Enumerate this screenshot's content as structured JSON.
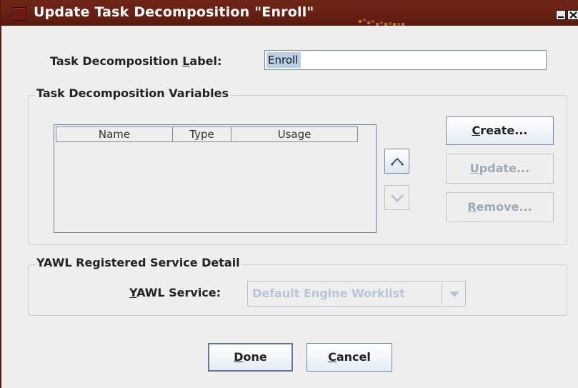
{
  "window": {
    "title": "Update Task Decomposition  \"Enroll\"",
    "minimize_icon": "minimize-icon",
    "close_icon": "close-icon"
  },
  "label_field": {
    "label_prefix": "Task Decomposition ",
    "label_mnemonic": "L",
    "label_suffix": "abel:",
    "value": "Enroll"
  },
  "variables": {
    "group_title": "Task Decomposition Variables",
    "columns": [
      "Name",
      "Type",
      "Usage"
    ],
    "rows": [],
    "move_up_icon": "chevron-up-icon",
    "move_down_icon": "chevron-down-icon",
    "buttons": {
      "create": {
        "mnemonic": "C",
        "rest": "reate...",
        "enabled": true
      },
      "update": {
        "mnemonic": "U",
        "rest": "pdate...",
        "enabled": false
      },
      "remove": {
        "mnemonic": "R",
        "rest": "emove...",
        "enabled": false
      }
    }
  },
  "service": {
    "group_title": "YAWL Registered Service Detail",
    "label_mnemonic": "Y",
    "label_rest": "AWL Service:",
    "selected": "Default Engine Worklist",
    "enabled": false
  },
  "footer": {
    "done": {
      "mnemonic": "D",
      "rest": "one"
    },
    "cancel": {
      "mnemonic": "C",
      "rest": "ancel"
    }
  }
}
